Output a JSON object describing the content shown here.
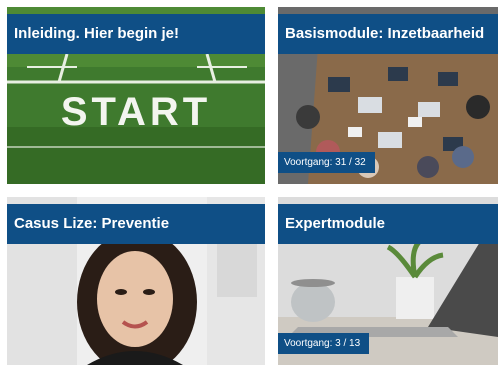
{
  "cards": [
    {
      "title": "Inleiding. Hier begin je!",
      "image": "start-field-image",
      "start_text": "START"
    },
    {
      "title": "Basismodule: Inzetbaarheid",
      "image": "meeting-table-image",
      "progress": "Voortgang: 31 / 32"
    },
    {
      "title": "Casus Lize: Preventie",
      "image": "woman-portrait-image"
    },
    {
      "title": "Expertmodule",
      "image": "desk-laptop-image",
      "progress": "Voortgang: 3 / 13"
    }
  ],
  "colors": {
    "title_bar": "#0f4f86",
    "progress_bar": "#0f4f86"
  }
}
